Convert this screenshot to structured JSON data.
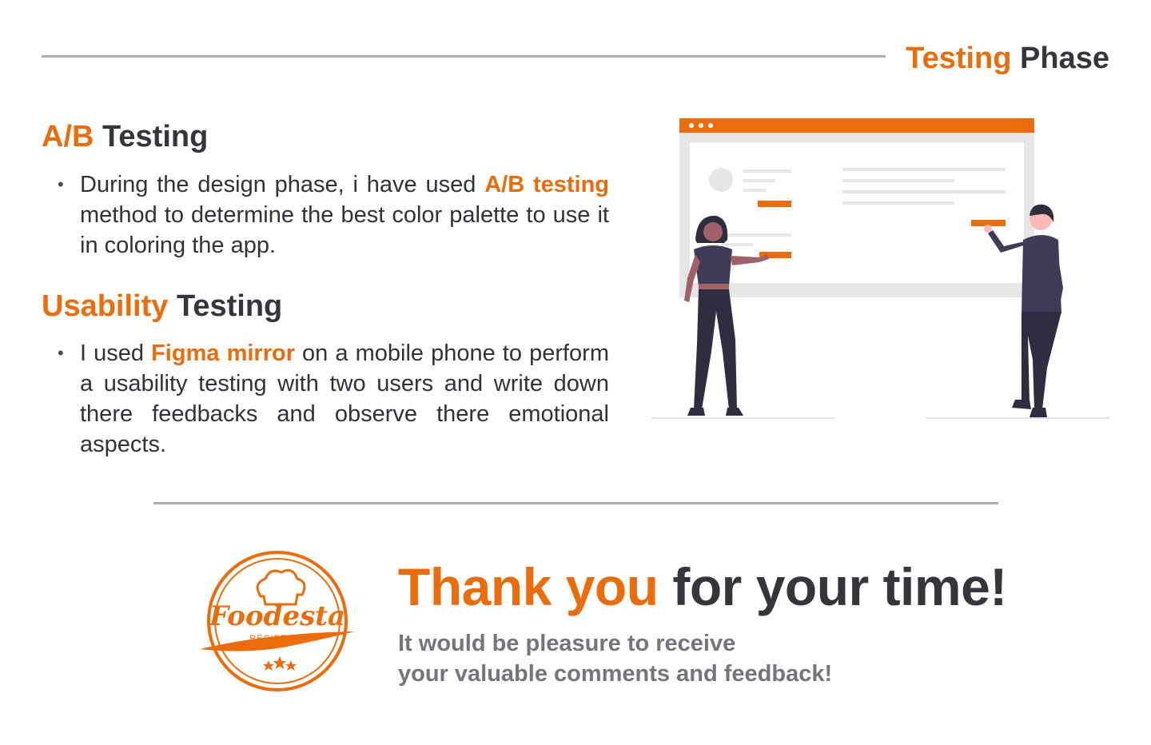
{
  "header": {
    "title_accent": "Testing",
    "title_rest": "Phase"
  },
  "ab_section": {
    "title_accent": "A/B",
    "title_rest": "Testing",
    "bullet": {
      "before": "During the design phase, i have used ",
      "highlight": "A/B testing",
      "after": " method to determine the best color palette to use it in coloring the app."
    }
  },
  "usability_section": {
    "title_accent": "Usability",
    "title_rest": "Testing",
    "bullet": {
      "before": "I used ",
      "highlight": "Figma mirror",
      "after": " on a mobile phone to perform a usability testing with two users and write down there feedbacks and observe there emotional aspects."
    }
  },
  "closing": {
    "thanks_accent": "Thank you",
    "thanks_rest": "for your time!",
    "line1": "It would be pleasure to receive",
    "line2": "your valuable comments and feedback!"
  },
  "logo": {
    "brand": "Foodesta",
    "tagline": "RECIPES"
  },
  "illustration": {
    "icon": "two-people-presenting-board-illustration"
  },
  "colors": {
    "accent": "#ea6c0b",
    "text_dark": "#33363b",
    "text_muted": "#72767b",
    "rule": "#a9adb1"
  }
}
